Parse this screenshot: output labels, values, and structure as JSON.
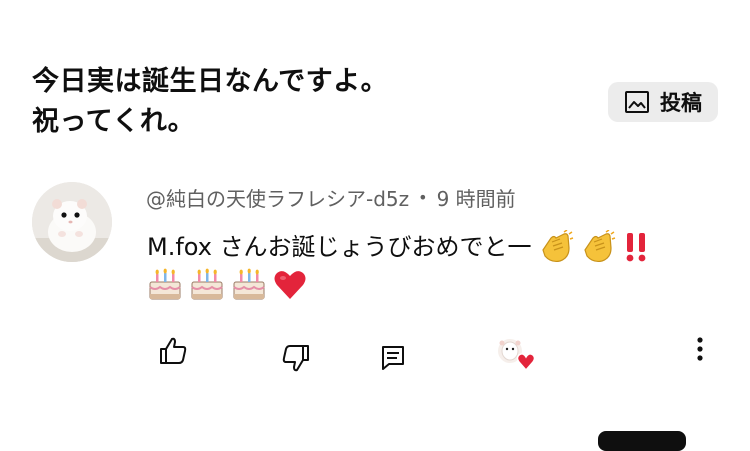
{
  "post": {
    "lines": [
      "今日実は誕生日なんですよ。",
      "祝ってくれ。"
    ],
    "post_button_label": "投稿"
  },
  "comment": {
    "author": "@純白の天使ラフレシア-d5z",
    "separator": "•",
    "time": "9 時間前",
    "text": "M.fox さんお誕じょうびおめでと一"
  },
  "icons": {
    "post_button": "image-icon",
    "actions": [
      "like-icon",
      "dislike-icon",
      "reply-icon",
      "creator-heart-icon",
      "more-icon"
    ],
    "emojis_line1": [
      "clapping-hands-emoji",
      "clapping-hands-emoji",
      "double-exclamation-emoji"
    ],
    "emojis_line2": [
      "birthday-cake-emoji",
      "birthday-cake-emoji",
      "birthday-cake-emoji",
      "red-heart-emoji"
    ]
  },
  "colors": {
    "text": "#0f0f0f",
    "meta": "#606060",
    "button_bg": "#ececec",
    "heart_red": "#e3243b"
  }
}
